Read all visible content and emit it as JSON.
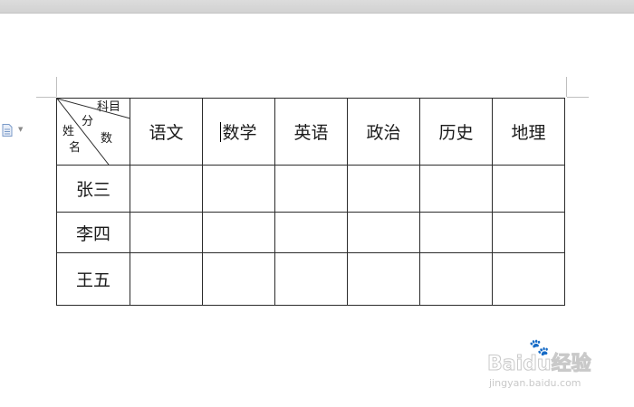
{
  "table": {
    "diagonal_header": {
      "top_right": "科目",
      "middle": "分",
      "bottom_right": "数",
      "left_top": "姓",
      "left_bottom": "名"
    },
    "subjects": [
      "语文",
      "数学",
      "英语",
      "政治",
      "历史",
      "地理"
    ],
    "students": [
      "张三",
      "李四",
      "王五"
    ]
  },
  "watermark": {
    "brand": "Baidu经验",
    "url": "jingyan.baidu.com"
  },
  "colors": {
    "border": "#2b2b2b",
    "topbar": "#d6d6d6",
    "watermark": "#c9c9c9"
  },
  "icons": {
    "side": "document-icon",
    "caret": "caret-down-icon",
    "watermark": "paw-icon"
  }
}
